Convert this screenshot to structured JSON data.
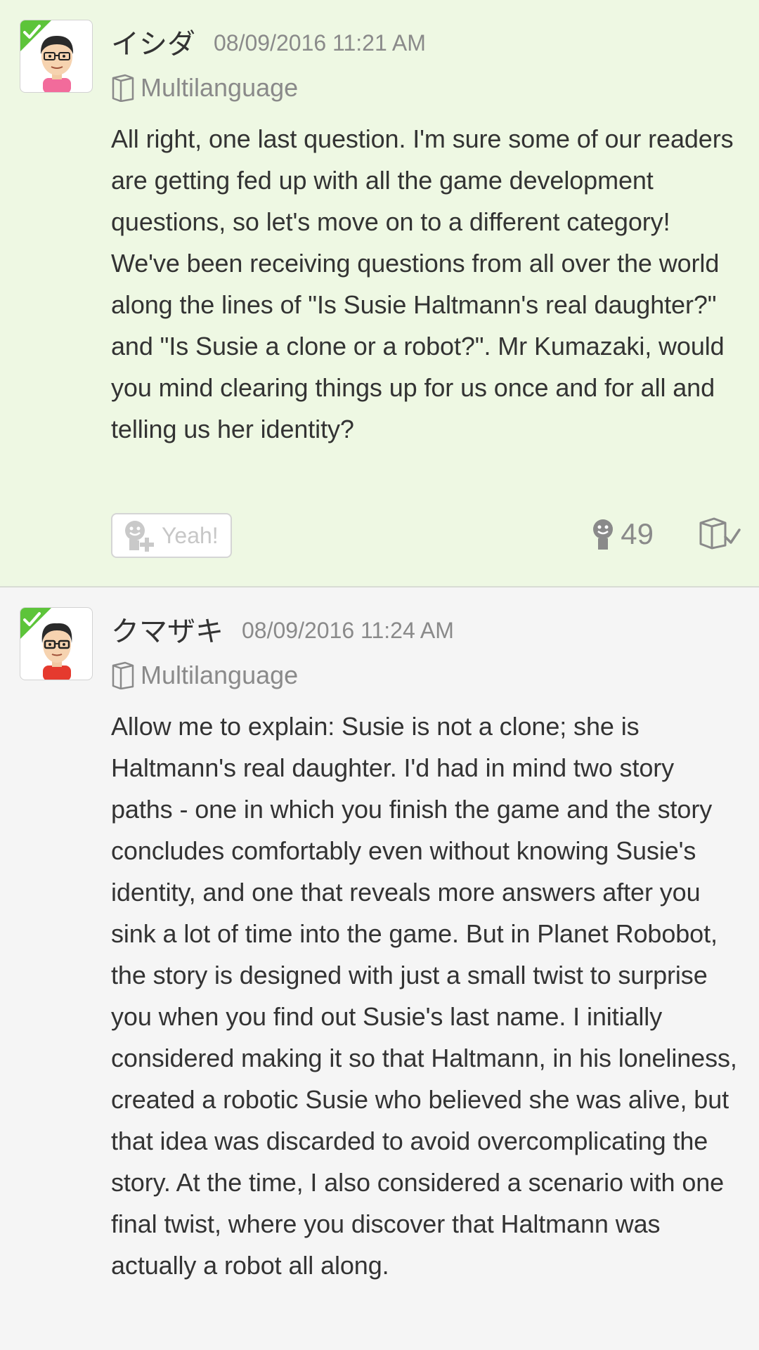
{
  "posts": [
    {
      "author": "イシダ",
      "timestamp": "08/09/2016 11:21 AM",
      "language": "Multilanguage",
      "body": "All right, one last question. I'm sure some of our readers are getting fed up with all the game development questions, so let's move on to a different category!\nWe've been receiving questions from all over the world along the lines of \"Is Susie Haltmann's real daughter?\" and \"Is Susie a clone or a robot?\". Mr Kumazaki, would you mind clearing things up for us once and for all and telling us her identity?",
      "yeah_label": "Yeah!",
      "yeah_count": "49",
      "avatar_shirt_color": "#f26b9b",
      "background": "#eef8e3"
    },
    {
      "author": "クマザキ",
      "timestamp": "08/09/2016 11:24 AM",
      "language": "Multilanguage",
      "body": "Allow me to explain: Susie is not a clone; she is Haltmann's real daughter. I'd had in mind two story paths - one in which you finish the game and the story concludes comfortably even without knowing Susie's identity, and one that reveals more answers after you sink a lot of time into the game. But in Planet Robobot, the story is designed with just a small twist to surprise you when you find out Susie's last name. I initially considered making it so that Haltmann, in his loneliness, created a robotic Susie who believed she was alive, but that idea was discarded to avoid overcomplicating the story. At the time, I also considered a scenario with one final twist, where you discover that Haltmann was actually a robot all along.",
      "avatar_shirt_color": "#e53a2e",
      "background": "#f5f5f5"
    }
  ],
  "colors": {
    "verified_badge": "#5dc43a",
    "muted_text": "#8a8a8a"
  },
  "icons": {
    "verified": "checkmark-corner-icon",
    "language": "book-icon",
    "yeah": "smiley-plus-icon",
    "yeah_count": "smiley-icon",
    "read": "book-check-icon"
  }
}
